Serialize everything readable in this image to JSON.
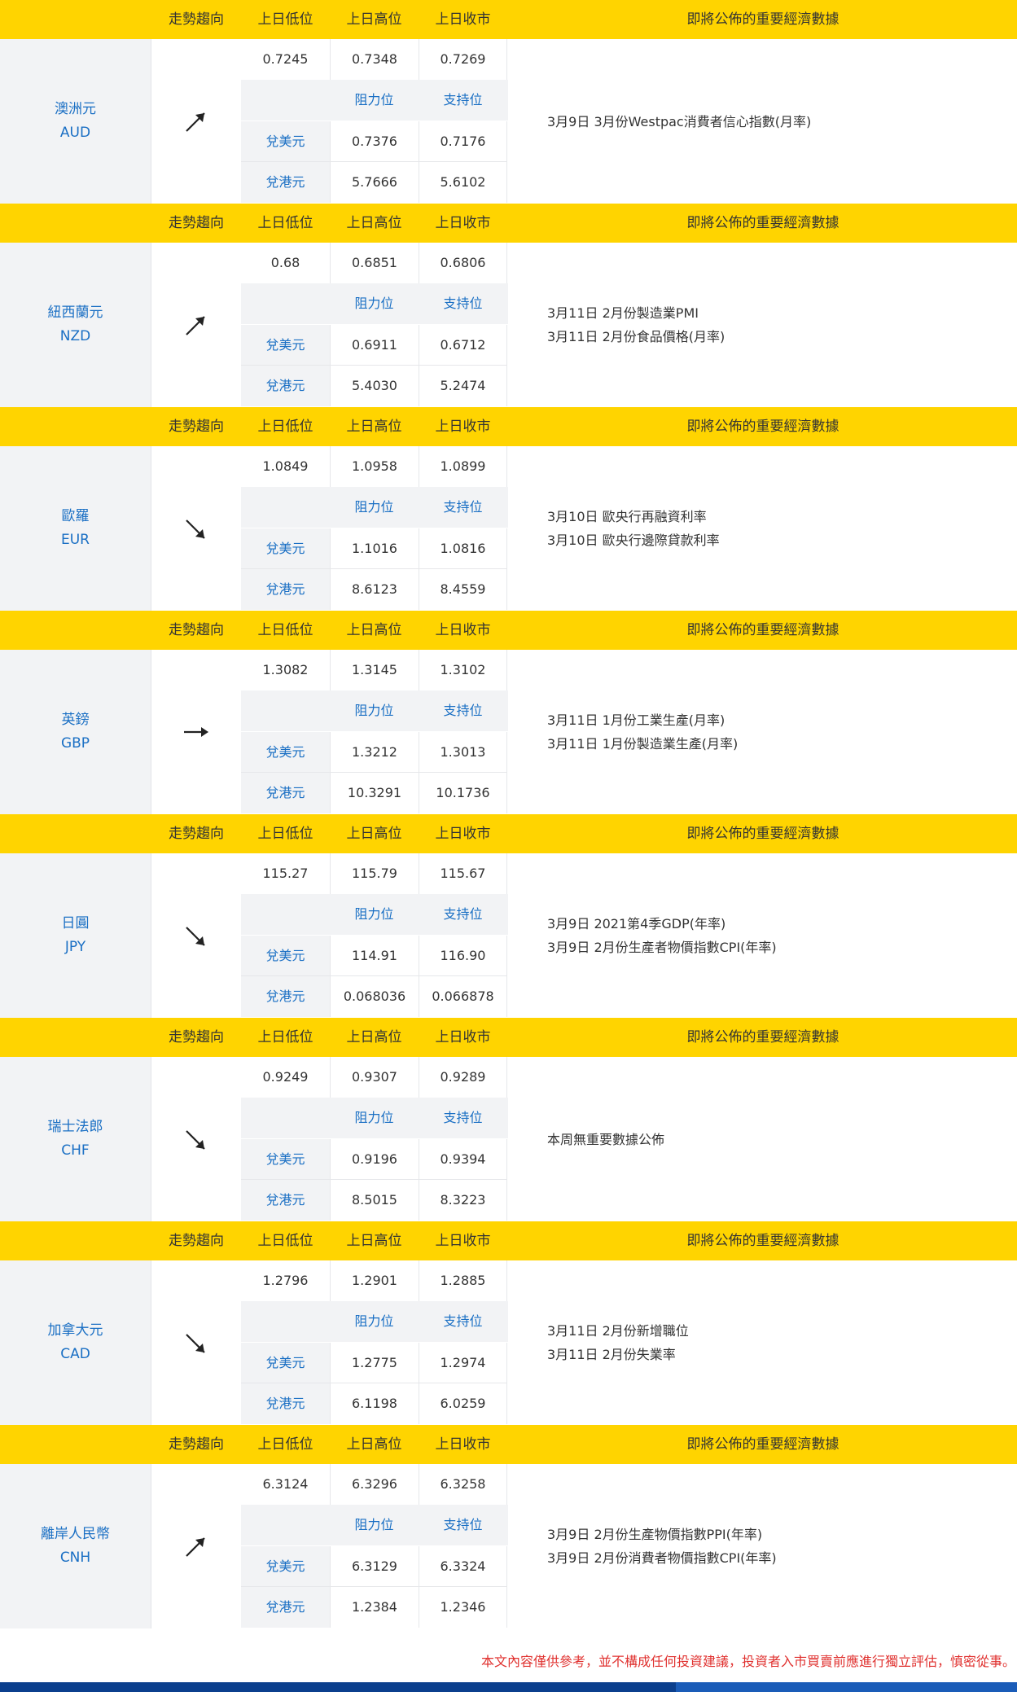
{
  "header": {
    "trend": "走勢趨向",
    "low": "上日低位",
    "high": "上日高位",
    "close": "上日收市",
    "events": "即將公佈的重要經濟數據"
  },
  "labels": {
    "resistance": "阻力位",
    "support": "支持位",
    "vs_usd": "兌美元",
    "vs_hkd": "兌港元"
  },
  "currencies": [
    {
      "name": "澳洲元",
      "code": "AUD",
      "trend": "up-right",
      "low": "0.7245",
      "high": "0.7348",
      "close": "0.7269",
      "usd_res": "0.7376",
      "usd_sup": "0.7176",
      "hkd_res": "5.7666",
      "hkd_sup": "5.6102",
      "events": [
        "3月9日 3月份Westpac消費者信心指數(月率)"
      ]
    },
    {
      "name": "紐西蘭元",
      "code": "NZD",
      "trend": "up-right",
      "low": "0.68",
      "high": "0.6851",
      "close": "0.6806",
      "usd_res": "0.6911",
      "usd_sup": "0.6712",
      "hkd_res": "5.4030",
      "hkd_sup": "5.2474",
      "events": [
        "3月11日 2月份製造業PMI",
        "3月11日 2月份食品價格(月率)"
      ]
    },
    {
      "name": "歐羅",
      "code": "EUR",
      "trend": "down-right",
      "low": "1.0849",
      "high": "1.0958",
      "close": "1.0899",
      "usd_res": "1.1016",
      "usd_sup": "1.0816",
      "hkd_res": "8.6123",
      "hkd_sup": "8.4559",
      "events": [
        "3月10日 歐央行再融資利率",
        "3月10日 歐央行邊際貸款利率"
      ]
    },
    {
      "name": "英鎊",
      "code": "GBP",
      "trend": "right",
      "low": "1.3082",
      "high": "1.3145",
      "close": "1.3102",
      "usd_res": "1.3212",
      "usd_sup": "1.3013",
      "hkd_res": "10.3291",
      "hkd_sup": "10.1736",
      "events": [
        "3月11日 1月份工業生產(月率)",
        "3月11日 1月份製造業生產(月率)"
      ]
    },
    {
      "name": "日圓",
      "code": "JPY",
      "trend": "down-right",
      "low": "115.27",
      "high": "115.79",
      "close": "115.67",
      "usd_res": "114.91",
      "usd_sup": "116.90",
      "hkd_res": "0.068036",
      "hkd_sup": "0.066878",
      "events": [
        "3月9日 2021第4季GDP(年率)",
        "3月9日 2月份生產者物價指數CPI(年率)"
      ]
    },
    {
      "name": "瑞士法郎",
      "code": "CHF",
      "trend": "down-right",
      "low": "0.9249",
      "high": "0.9307",
      "close": "0.9289",
      "usd_res": "0.9196",
      "usd_sup": "0.9394",
      "hkd_res": "8.5015",
      "hkd_sup": "8.3223",
      "events": [
        "本周無重要數據公佈"
      ]
    },
    {
      "name": "加拿大元",
      "code": "CAD",
      "trend": "down-right",
      "low": "1.2796",
      "high": "1.2901",
      "close": "1.2885",
      "usd_res": "1.2775",
      "usd_sup": "1.2974",
      "hkd_res": "6.1198",
      "hkd_sup": "6.0259",
      "events": [
        "3月11日 2月份新增職位",
        "3月11日 2月份失業率"
      ]
    },
    {
      "name": "離岸人民幣",
      "code": "CNH",
      "trend": "up-right",
      "low": "6.3124",
      "high": "6.3296",
      "close": "6.3258",
      "usd_res": "6.3129",
      "usd_sup": "6.3324",
      "hkd_res": "1.2384",
      "hkd_sup": "1.2346",
      "events": [
        "3月9日 2月份生產物價指數PPI(年率)",
        "3月9日 2月份消費者物價指數CPI(年率)"
      ]
    }
  ],
  "disclaimer": "本文內容僅供參考，並不構成任何投資建議，投資者入市買賣前應進行獨立評估，慎密從事。",
  "colors": {
    "header_bg": "#ffd400",
    "accent_blue": "#1a6fc4",
    "disclaimer_red": "#e0312f",
    "footer_blue": "#0b3f8d"
  }
}
